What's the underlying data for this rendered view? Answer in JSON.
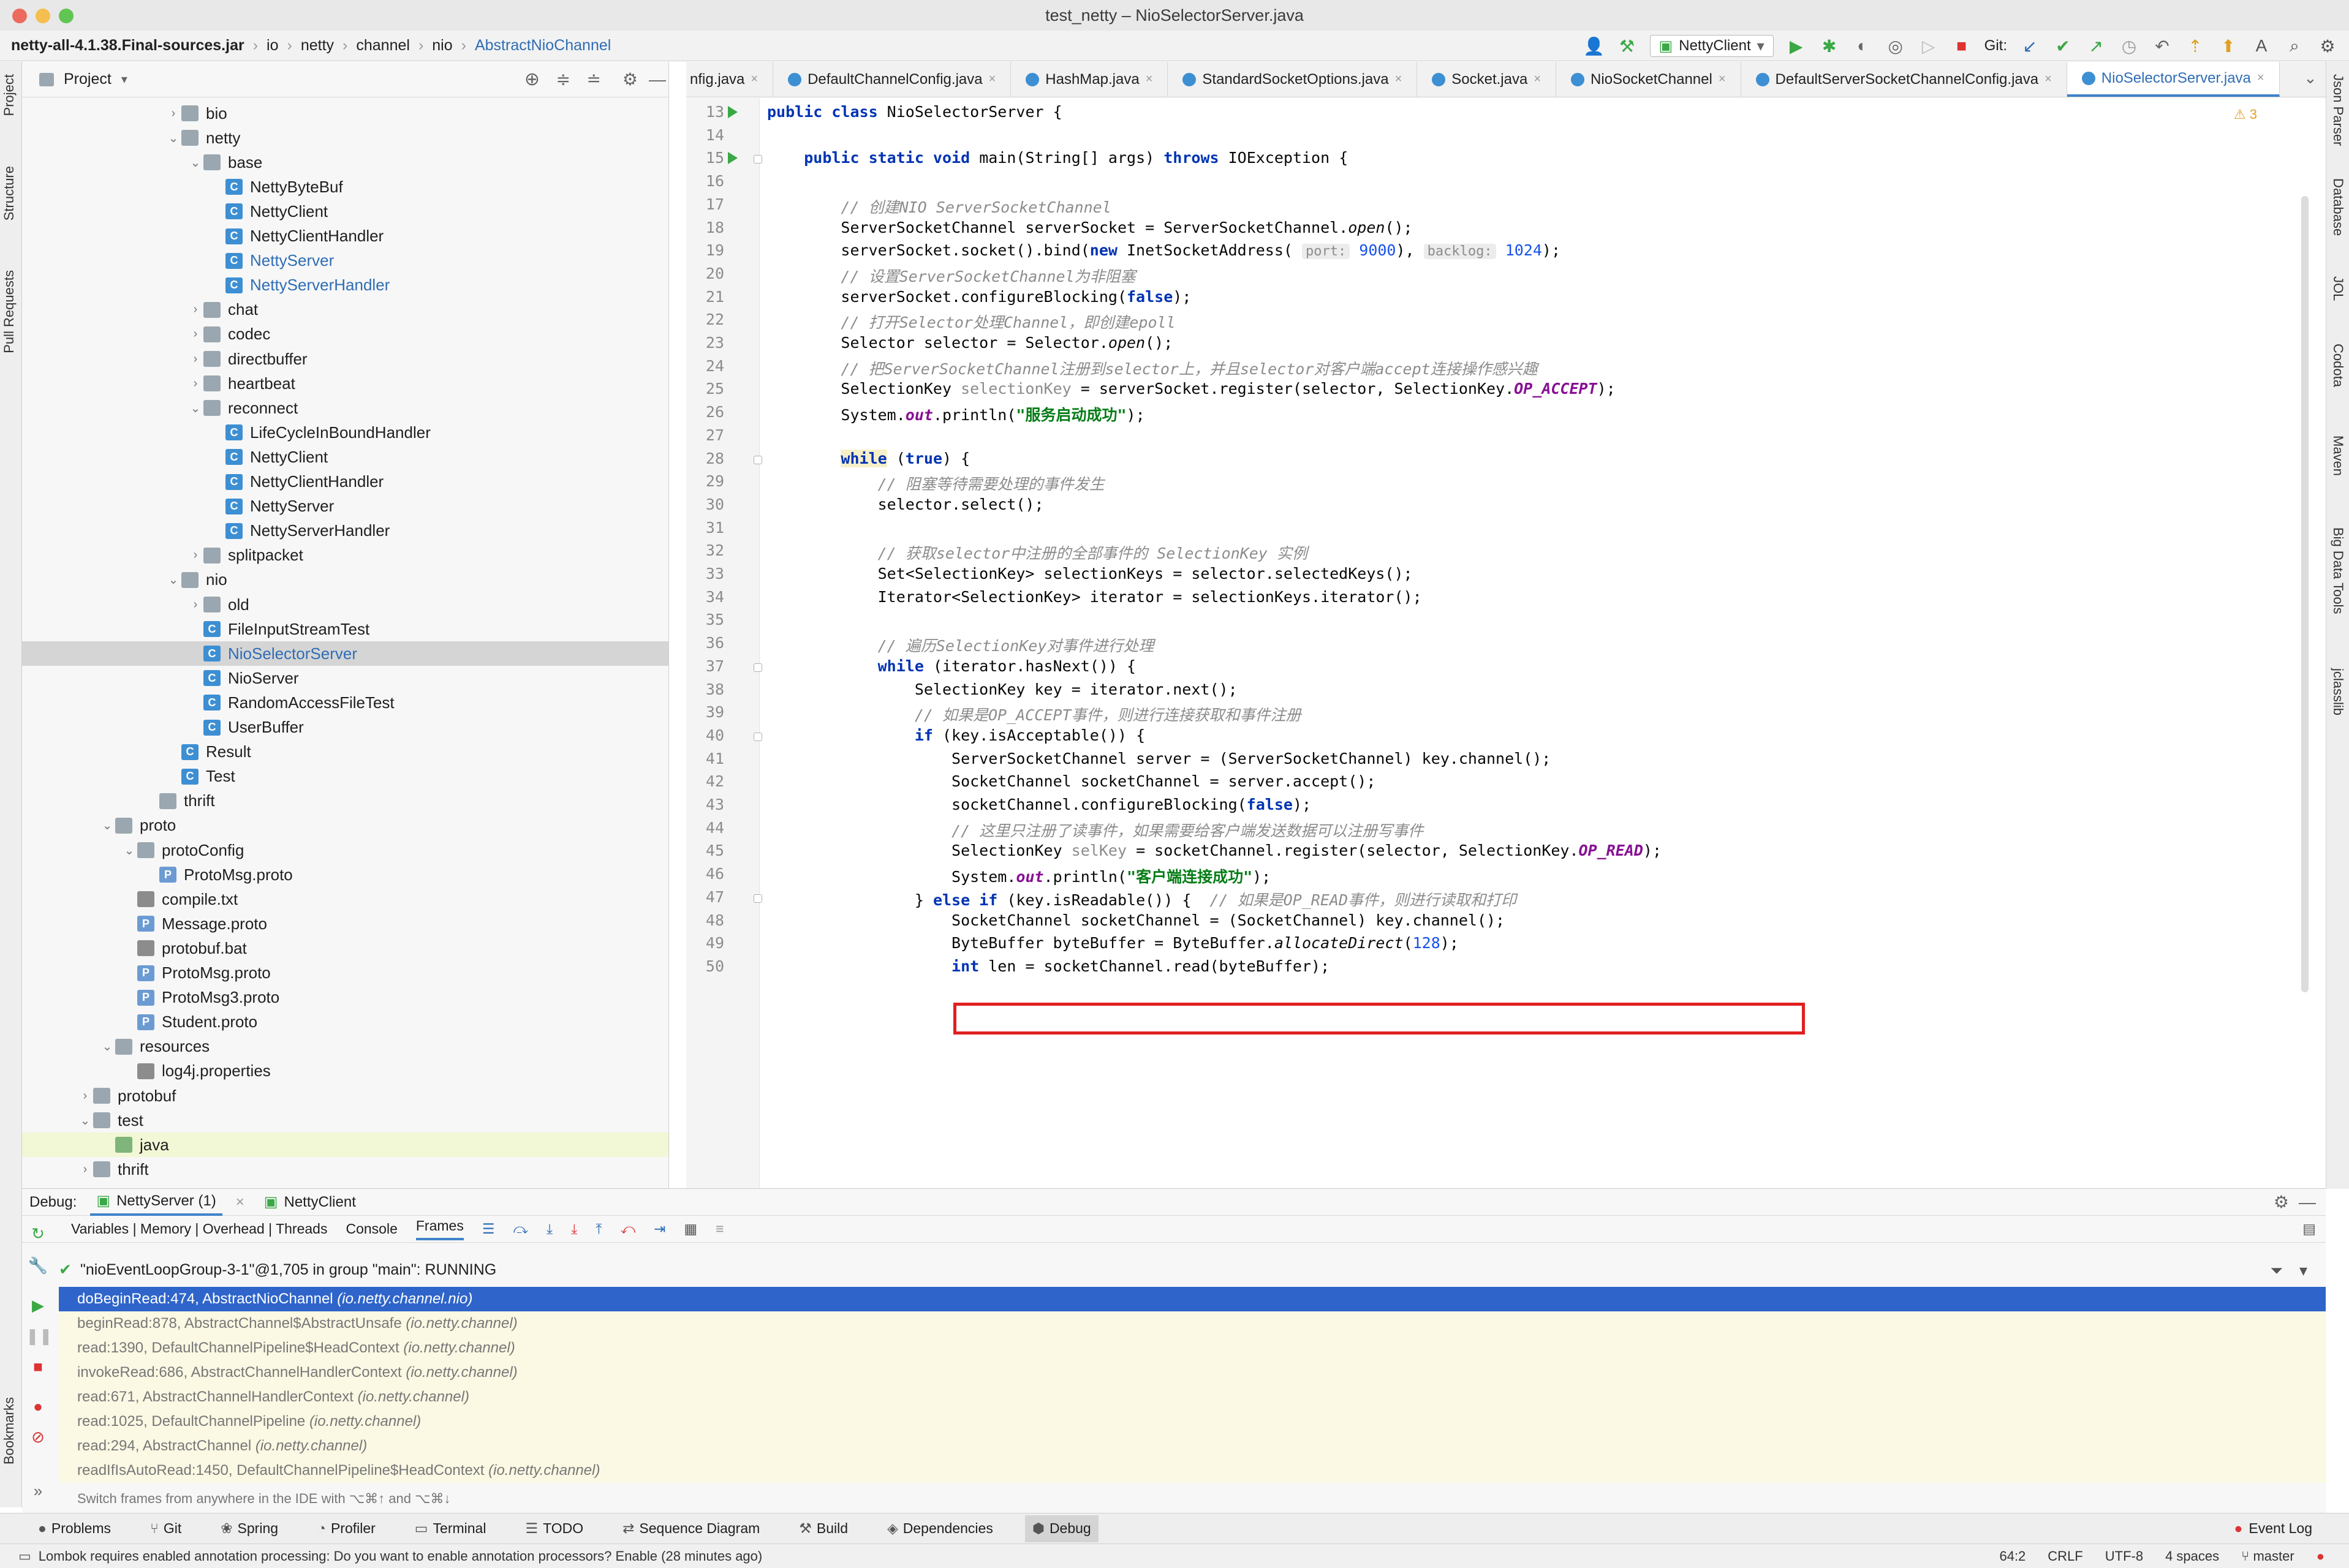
{
  "window": {
    "title": "test_netty – NioSelectorServer.java"
  },
  "breadcrumbs": [
    "netty-all-4.1.38.Final-sources.jar",
    "io",
    "netty",
    "channel",
    "nio",
    "AbstractNioChannel"
  ],
  "toolbar": {
    "run_config": "NettyClient",
    "git_label": "Git:"
  },
  "left_strip": [
    "Project",
    "Structure",
    "Pull Requests",
    "Bookmarks"
  ],
  "right_strip": [
    "Json Parser",
    "Database",
    "JOL",
    "Codota",
    "Maven",
    "Big Data Tools",
    "jclasslib"
  ],
  "project": {
    "title": "Project",
    "tree": [
      {
        "label": "bio",
        "type": "folder",
        "depth": 6,
        "arrow": "›"
      },
      {
        "label": "netty",
        "type": "folder",
        "depth": 6,
        "arrow": "⌄"
      },
      {
        "label": "base",
        "type": "folder",
        "depth": 7,
        "arrow": "⌄"
      },
      {
        "label": "NettyByteBuf",
        "type": "class",
        "depth": 8,
        "arrow": ""
      },
      {
        "label": "NettyClient",
        "type": "class",
        "depth": 8,
        "arrow": ""
      },
      {
        "label": "NettyClientHandler",
        "type": "class",
        "depth": 8,
        "arrow": ""
      },
      {
        "label": "NettyServer",
        "type": "class",
        "depth": 8,
        "arrow": "",
        "blue": true
      },
      {
        "label": "NettyServerHandler",
        "type": "class",
        "depth": 8,
        "arrow": "",
        "blue": true
      },
      {
        "label": "chat",
        "type": "folder",
        "depth": 7,
        "arrow": "›"
      },
      {
        "label": "codec",
        "type": "folder",
        "depth": 7,
        "arrow": "›"
      },
      {
        "label": "directbuffer",
        "type": "folder",
        "depth": 7,
        "arrow": "›"
      },
      {
        "label": "heartbeat",
        "type": "folder",
        "depth": 7,
        "arrow": "›"
      },
      {
        "label": "reconnect",
        "type": "folder",
        "depth": 7,
        "arrow": "⌄"
      },
      {
        "label": "LifeCycleInBoundHandler",
        "type": "class",
        "depth": 8,
        "arrow": ""
      },
      {
        "label": "NettyClient",
        "type": "class",
        "depth": 8,
        "arrow": ""
      },
      {
        "label": "NettyClientHandler",
        "type": "class",
        "depth": 8,
        "arrow": ""
      },
      {
        "label": "NettyServer",
        "type": "class",
        "depth": 8,
        "arrow": ""
      },
      {
        "label": "NettyServerHandler",
        "type": "class",
        "depth": 8,
        "arrow": ""
      },
      {
        "label": "splitpacket",
        "type": "folder",
        "depth": 7,
        "arrow": "›"
      },
      {
        "label": "nio",
        "type": "folder",
        "depth": 6,
        "arrow": "⌄"
      },
      {
        "label": "old",
        "type": "folder",
        "depth": 7,
        "arrow": "›"
      },
      {
        "label": "FileInputStreamTest",
        "type": "class",
        "depth": 7,
        "arrow": ""
      },
      {
        "label": "NioSelectorServer",
        "type": "class",
        "depth": 7,
        "arrow": "",
        "selected": true,
        "blue": true
      },
      {
        "label": "NioServer",
        "type": "class",
        "depth": 7,
        "arrow": ""
      },
      {
        "label": "RandomAccessFileTest",
        "type": "class",
        "depth": 7,
        "arrow": ""
      },
      {
        "label": "UserBuffer",
        "type": "class",
        "depth": 7,
        "arrow": ""
      },
      {
        "label": "Result",
        "type": "class",
        "depth": 6,
        "arrow": ""
      },
      {
        "label": "Test",
        "type": "class",
        "depth": 6,
        "arrow": ""
      },
      {
        "label": "thrift",
        "type": "folder",
        "depth": 5,
        "arrow": ""
      },
      {
        "label": "proto",
        "type": "folder",
        "depth": 3,
        "arrow": "⌄"
      },
      {
        "label": "protoConfig",
        "type": "folder",
        "depth": 4,
        "arrow": "⌄"
      },
      {
        "label": "ProtoMsg.proto",
        "type": "proto",
        "depth": 5,
        "arrow": ""
      },
      {
        "label": "compile.txt",
        "type": "txt",
        "depth": 4,
        "arrow": ""
      },
      {
        "label": "Message.proto",
        "type": "proto",
        "depth": 4,
        "arrow": ""
      },
      {
        "label": "protobuf.bat",
        "type": "txt",
        "depth": 4,
        "arrow": ""
      },
      {
        "label": "ProtoMsg.proto",
        "type": "proto",
        "depth": 4,
        "arrow": ""
      },
      {
        "label": "ProtoMsg3.proto",
        "type": "proto",
        "depth": 4,
        "arrow": ""
      },
      {
        "label": "Student.proto",
        "type": "proto",
        "depth": 4,
        "arrow": ""
      },
      {
        "label": "resources",
        "type": "folder",
        "depth": 3,
        "arrow": "⌄"
      },
      {
        "label": "log4j.properties",
        "type": "txt",
        "depth": 4,
        "arrow": ""
      },
      {
        "label": "protobuf",
        "type": "folder",
        "depth": 2,
        "arrow": "›"
      },
      {
        "label": "test",
        "type": "folder",
        "depth": 2,
        "arrow": "⌄"
      },
      {
        "label": "java",
        "type": "src",
        "depth": 3,
        "arrow": "",
        "highlight": true
      },
      {
        "label": "thrift",
        "type": "folder",
        "depth": 2,
        "arrow": "›"
      }
    ]
  },
  "editor_tabs": [
    {
      "label": "nfig.java",
      "active": false
    },
    {
      "label": "DefaultChannelConfig.java",
      "active": false
    },
    {
      "label": "HashMap.java",
      "active": false
    },
    {
      "label": "StandardSocketOptions.java",
      "active": false
    },
    {
      "label": "Socket.java",
      "active": false
    },
    {
      "label": "NioSocketChannel",
      "active": false
    },
    {
      "label": "DefaultServerSocketChannelConfig.java",
      "active": false
    },
    {
      "label": "NioSelectorServer.java",
      "active": true
    }
  ],
  "editor": {
    "warning_count": "3",
    "lines": [
      {
        "n": "13",
        "html": "<span class='kw'>public class</span> NioSelectorServer {"
      },
      {
        "n": "14",
        "html": ""
      },
      {
        "n": "15",
        "html": "    <span class='kw'>public static void</span> main(String[] args) <span class='kw'>throws</span> IOException {"
      },
      {
        "n": "16",
        "html": ""
      },
      {
        "n": "17",
        "html": "        <span class='cm'>// 创建NIO ServerSocketChannel</span>"
      },
      {
        "n": "18",
        "html": "        ServerSocketChannel serverSocket = ServerSocketChannel.<span class='mth'>open</span>();"
      },
      {
        "n": "19",
        "html": "        serverSocket.socket().bind(<span class='kw'>new</span> InetSocketAddress( <span class='hint'>port:</span> <span class='num'>9000</span>), <span class='hint'>backlog:</span> <span class='num'>1024</span>);"
      },
      {
        "n": "20",
        "html": "        <span class='cm'>// 设置ServerSocketChannel为非阻塞</span>"
      },
      {
        "n": "21",
        "html": "        serverSocket.configureBlocking(<span class='kw'>false</span>);"
      },
      {
        "n": "22",
        "html": "        <span class='cm'>// 打开Selector处理Channel，即创建epoll</span>"
      },
      {
        "n": "23",
        "html": "        Selector selector = Selector.<span class='mth'>open</span>();"
      },
      {
        "n": "24",
        "html": "        <span class='cm'>// 把ServerSocketChannel注册到selector上，并且selector对客户端accept连接操作感兴趣</span>"
      },
      {
        "n": "25",
        "html": "        SelectionKey <span class='unused'>selectionKey</span> = serverSocket.register(selector, SelectionKey.<span class='fld'>OP_ACCEPT</span>);"
      },
      {
        "n": "26",
        "html": "        System.<span class='fld'>out</span>.println(<span class='str'>\"服务启动成功\"</span>);"
      },
      {
        "n": "27",
        "html": ""
      },
      {
        "n": "28",
        "html": "        <span class='kw while-hl'>while</span> (<span class='kw'>true</span>) {"
      },
      {
        "n": "29",
        "html": "            <span class='cm'>// 阻塞等待需要处理的事件发生</span>"
      },
      {
        "n": "30",
        "html": "            selector.select();"
      },
      {
        "n": "31",
        "html": ""
      },
      {
        "n": "32",
        "html": "            <span class='cm'>// 获取selector中注册的全部事件的 SelectionKey 实例</span>"
      },
      {
        "n": "33",
        "html": "            Set&lt;SelectionKey&gt; selectionKeys = selector.selectedKeys();"
      },
      {
        "n": "34",
        "html": "            Iterator&lt;SelectionKey&gt; iterator = selectionKeys.iterator();"
      },
      {
        "n": "35",
        "html": ""
      },
      {
        "n": "36",
        "html": "            <span class='cm'>// 遍历SelectionKey对事件进行处理</span>"
      },
      {
        "n": "37",
        "html": "            <span class='kw'>while</span> (iterator.hasNext()) {"
      },
      {
        "n": "38",
        "html": "                SelectionKey key = iterator.next();"
      },
      {
        "n": "39",
        "html": "                <span class='cm'>// 如果是OP_ACCEPT事件，则进行连接获取和事件注册</span>"
      },
      {
        "n": "40",
        "html": "                <span class='kw'>if</span> (key.isAcceptable()) {"
      },
      {
        "n": "41",
        "html": "                    ServerSocketChannel server = (ServerSocketChannel) key.channel();"
      },
      {
        "n": "42",
        "html": "                    SocketChannel socketChannel = server.accept();"
      },
      {
        "n": "43",
        "html": "                    socketChannel.configureBlocking(<span class='kw'>false</span>);"
      },
      {
        "n": "44",
        "html": "                    <span class='cm'>// 这里只注册了读事件，如果需要给客户端发送数据可以注册写事件</span>"
      },
      {
        "n": "45",
        "html": "                    SelectionKey <span class='unused'>selKey</span> = socketChannel.register(selector, SelectionKey.<span class='fld'>OP_READ</span>);"
      },
      {
        "n": "46",
        "html": "                    System.<span class='fld'>out</span>.println(<span class='str'>\"客户端连接成功\"</span>);"
      },
      {
        "n": "47",
        "html": "                } <span class='kw'>else if</span> (key.isReadable()) {  <span class='cm'>// 如果是OP_READ事件，则进行读取和打印</span>"
      },
      {
        "n": "48",
        "html": "                    SocketChannel socketChannel = (SocketChannel) key.channel();"
      },
      {
        "n": "49",
        "html": "                    ByteBuffer byteBuffer = ByteBuffer.<span class='mth'>allocateDirect</span>(<span class='num'>128</span>);"
      },
      {
        "n": "50",
        "html": "                    <span class='kw'>int</span> len = socketChannel.read(byteBuffer);"
      }
    ]
  },
  "debug": {
    "label": "Debug:",
    "tabs": [
      {
        "label": "NettyServer (1)",
        "active": true
      },
      {
        "label": "NettyClient",
        "active": false
      }
    ],
    "subtabs": [
      "Variables | Memory | Overhead | Threads",
      "Console",
      "Frames"
    ],
    "active_subtab": "Frames",
    "thread": "\"nioEventLoopGroup-3-1\"@1,705 in group \"main\": RUNNING",
    "frames": [
      {
        "method": "doBeginRead:474, AbstractNioChannel",
        "pkg": "(io.netty.channel.nio)",
        "selected": true
      },
      {
        "method": "beginRead:878, AbstractChannel$AbstractUnsafe",
        "pkg": "(io.netty.channel)"
      },
      {
        "method": "read:1390, DefaultChannelPipeline$HeadContext",
        "pkg": "(io.netty.channel)"
      },
      {
        "method": "invokeRead:686, AbstractChannelHandlerContext",
        "pkg": "(io.netty.channel)"
      },
      {
        "method": "read:671, AbstractChannelHandlerContext",
        "pkg": "(io.netty.channel)"
      },
      {
        "method": "read:1025, DefaultChannelPipeline",
        "pkg": "(io.netty.channel)"
      },
      {
        "method": "read:294, AbstractChannel",
        "pkg": "(io.netty.channel)"
      },
      {
        "method": "readIfIsAutoRead:1450, DefaultChannelPipeline$HeadContext",
        "pkg": "(io.netty.channel)"
      }
    ],
    "hint": "Switch frames from anywhere in the IDE with ⌥⌘↑ and ⌥⌘↓"
  },
  "tool_tabs": [
    {
      "label": "Problems",
      "icon": "●"
    },
    {
      "label": "Git",
      "icon": "⑂"
    },
    {
      "label": "Spring",
      "icon": "❀"
    },
    {
      "label": "Profiler",
      "icon": "◔"
    },
    {
      "label": "Terminal",
      "icon": "▭"
    },
    {
      "label": "TODO",
      "icon": "☰"
    },
    {
      "label": "Sequence Diagram",
      "icon": "⇄"
    },
    {
      "label": "Build",
      "icon": "⚒"
    },
    {
      "label": "Dependencies",
      "icon": "◈"
    },
    {
      "label": "Debug",
      "icon": "⬢",
      "active": true
    }
  ],
  "event_log": "Event Log",
  "status": {
    "message": "Lombok requires enabled annotation processing: Do you want to enable annotation processors? Enable (28 minutes ago)",
    "position": "64:2",
    "line_sep": "CRLF",
    "encoding": "UTF-8",
    "indent": "4 spaces",
    "branch": "master"
  }
}
